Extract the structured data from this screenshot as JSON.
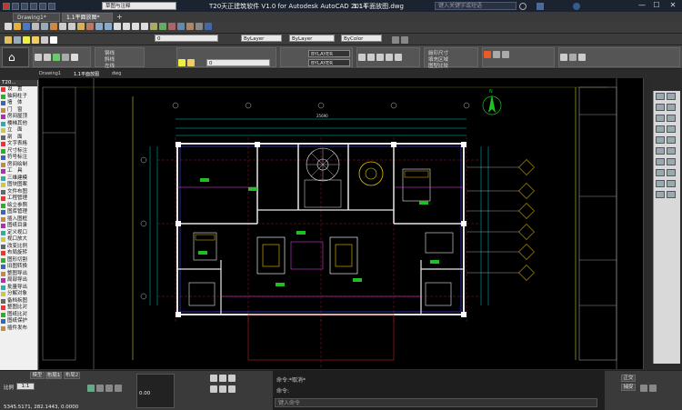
{
  "titlebar": {
    "app_title": "T20天正建筑软件 V1.0 for Autodesk AutoCAD 2014",
    "file_name": "1.1平面放图.dwg",
    "search_placeholder": "键入关键字或短语",
    "minimize": "—",
    "maximize": "☐",
    "close": "✕"
  },
  "doc_tabs": [
    {
      "label": "Drawing1*"
    },
    {
      "label": "1.1平面放图*"
    }
  ],
  "workspace_dropdown": "草图与注释",
  "toolbar": {
    "layer_dropdown": "0",
    "linetype_dropdown": "ByLayer",
    "lineweight_dropdown": "ByLayer",
    "color_dropdown": "ByColor"
  },
  "ribbon": {
    "rows": [
      "钢线",
      "斜线",
      "左线"
    ],
    "layer_value": "0",
    "bylayer_a": "BYLAYER",
    "bylayer_b": "BYLAYER",
    "right_group": [
      "繪印尺寸",
      "填充区域",
      "图型比较"
    ]
  },
  "cad_tabs": [
    "Drawing1",
    "1.1平面放图",
    "dwg"
  ],
  "left_palette": {
    "header": "T20...",
    "items": [
      "设　置",
      "轴网柱子",
      "墙　体",
      "门　窗",
      "房间屋顶",
      "楼梯其他",
      "立　面",
      "剖　面",
      "文字表格",
      "尺寸标注",
      "符号标注",
      "房间绘制",
      "工　具",
      "三维建模",
      "图块图案",
      "文件布图",
      "工程管理",
      "绘立参照",
      "图库管理",
      "插入图框",
      "图纸目录",
      "定义视口",
      "视口放大",
      "改变比例",
      "布局旋转",
      "图形切割",
      "旧图转换",
      "整图导出",
      "局部导出",
      "批量导出",
      "分解对象",
      "备档拆图",
      "整图比对",
      "图纸比对",
      "图纸保护",
      "插件发布"
    ]
  },
  "bottom": {
    "model_tab": "模型",
    "layout1_tab": "布局1",
    "layout2_tab": "布局2",
    "scale_label": "比例",
    "scale_value": "1:1",
    "coords": "5345.5171, 282.1443, 0.0000",
    "cmd_line1": "命令:*取消*",
    "cmd_line2": "命令:",
    "cmd_placeholder": "键入命令",
    "zoom_value": "0.00",
    "btn_ortho": "正交",
    "btn_snap": "捕捉"
  },
  "drawing": {
    "compass_label": "N",
    "dimension_top": "25690"
  }
}
